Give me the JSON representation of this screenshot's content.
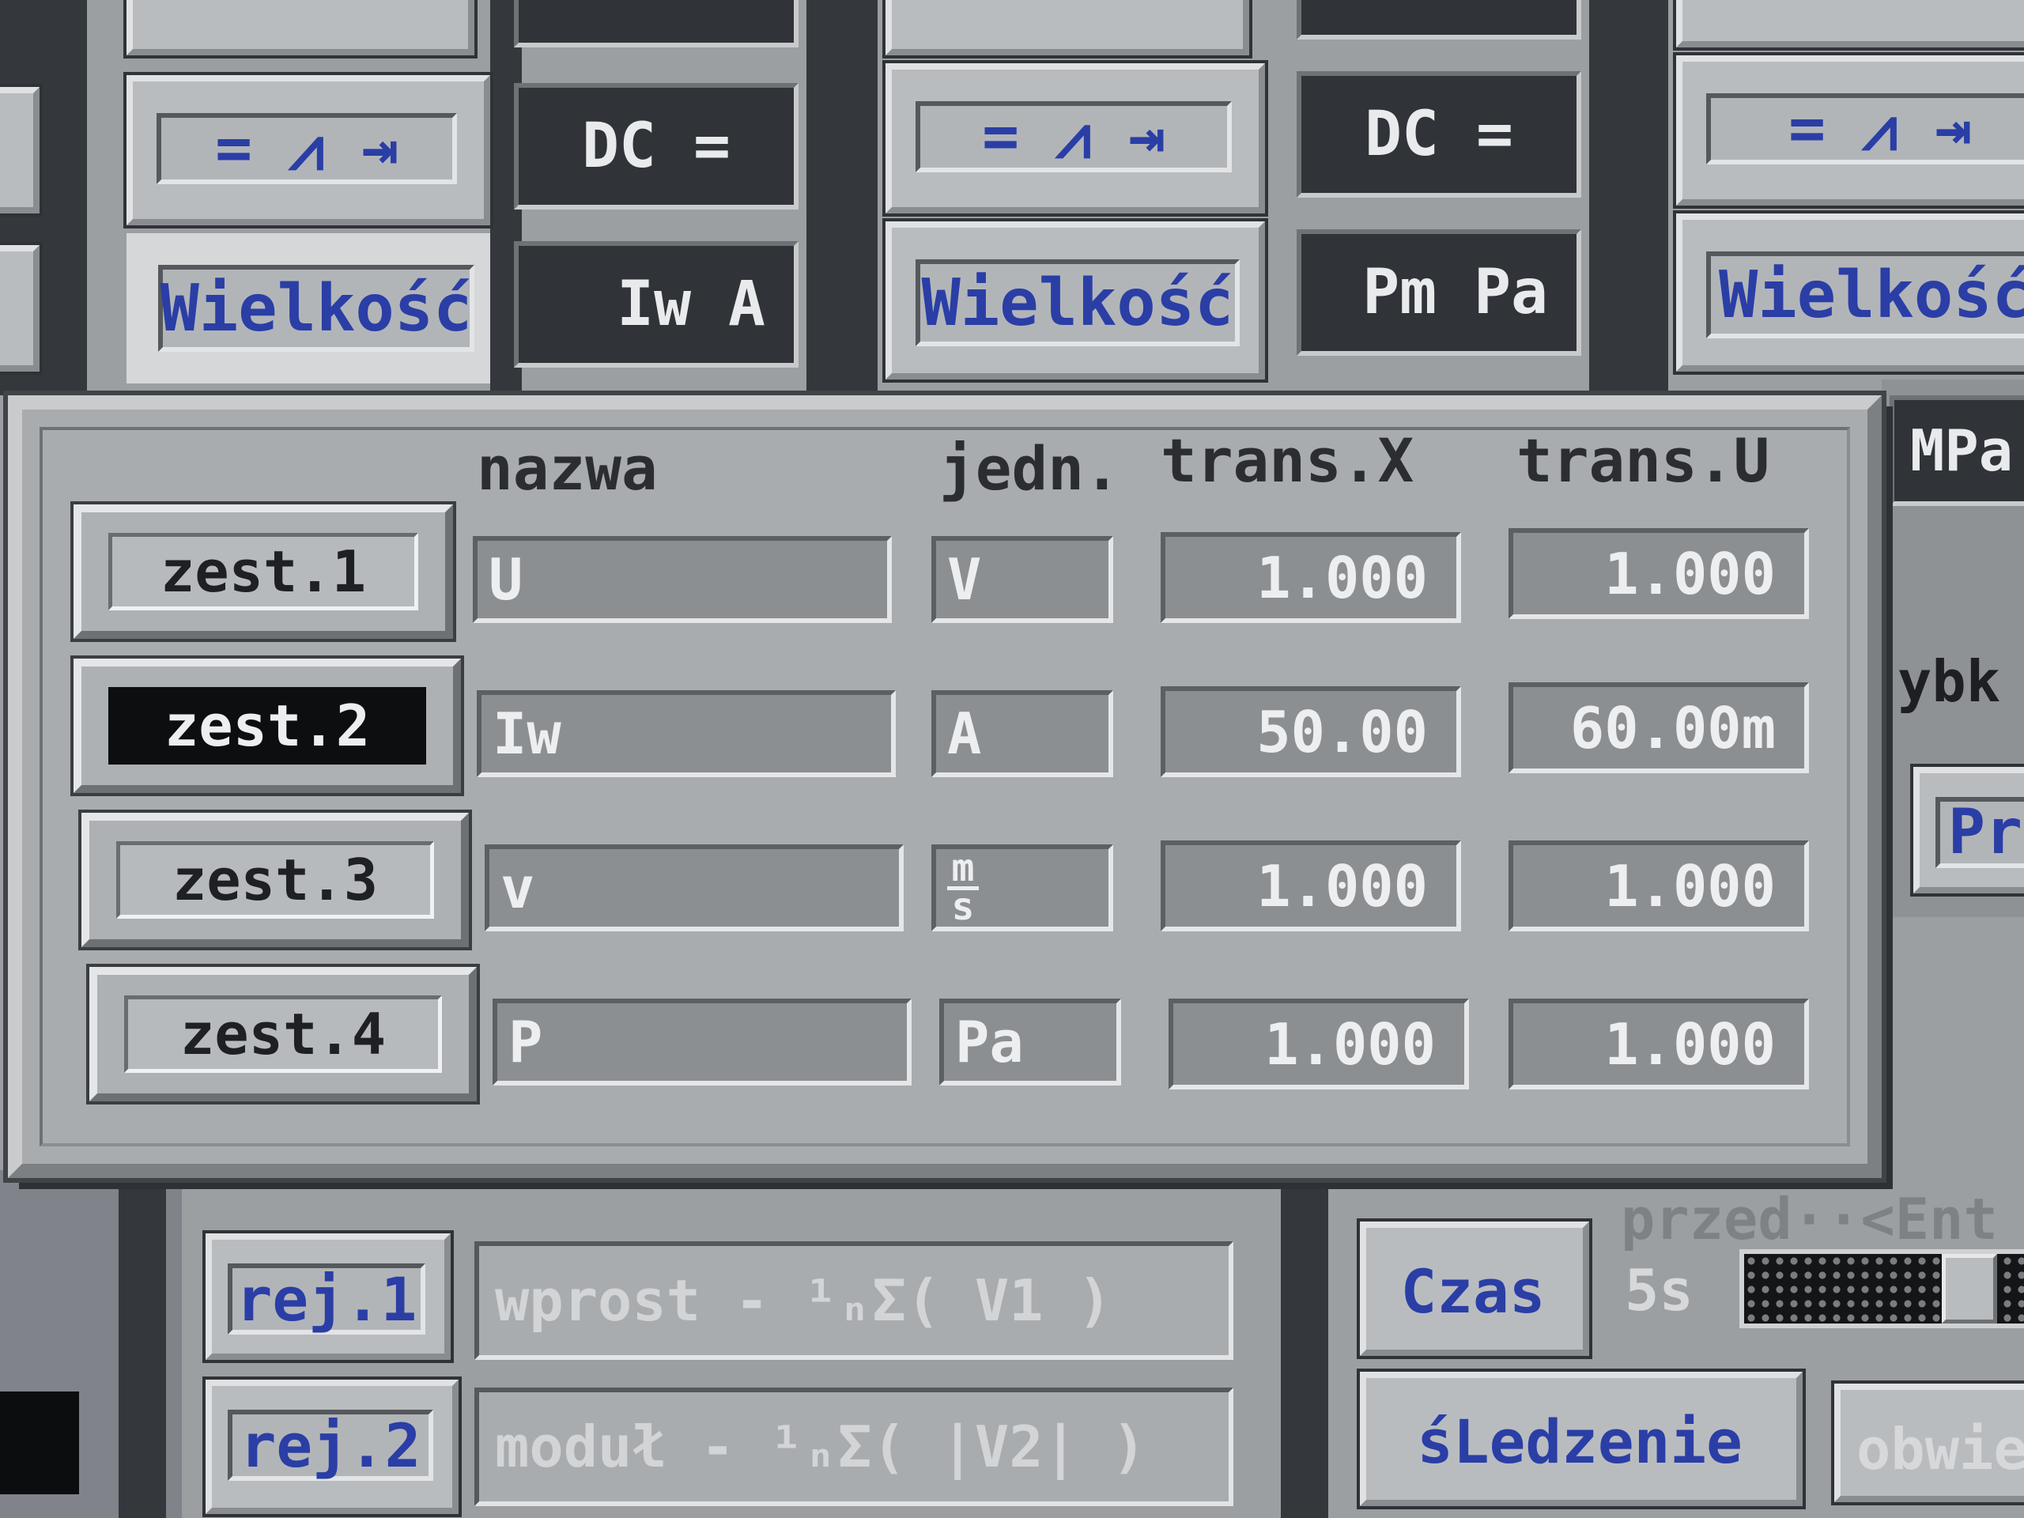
{
  "background": {
    "row_top": {
      "left": {
        "symbols": "= ⩘ ⇥",
        "dc": "DC =",
        "wielkosc": "Wielkość",
        "value": "Iw A"
      },
      "middle": {
        "symbols": "= ⩘ ⇥",
        "dc": "DC =",
        "wielkosc": "Wielkość",
        "value": "Pm Pa"
      },
      "right": {
        "symbols": "= ⩘ ⇥",
        "wielkosc": "Wielkość"
      }
    },
    "right_side": {
      "mpa": "MPa",
      "ybk": "ybk",
      "pr": "Pr"
    },
    "bottom": {
      "rej1": "rej.1",
      "rej1_formula": "wprost  -  ¹ₙΣ(  V1  )",
      "rej2": "rej.2",
      "rej2_formula": "moduł  -  ¹ₙΣ( |V2| )",
      "czas": "Czas",
      "przed": "przed··<Ent",
      "time": "5s",
      "sledzenie": "śLedzenie",
      "obwi": "obwie"
    }
  },
  "dialog": {
    "headers": {
      "name": "nazwa",
      "unit": "jedn.",
      "transx": "trans.X",
      "transu": "trans.U"
    },
    "rows": [
      {
        "set": "zest.1",
        "name": "U",
        "unit": "V",
        "transx": "1.000",
        "transu": "1.000",
        "active": false
      },
      {
        "set": "zest.2",
        "name": "Iw",
        "unit": "A",
        "transx": "50.00",
        "transu": "60.00m",
        "active": true
      },
      {
        "set": "zest.3",
        "name": "v",
        "unit_num": "m",
        "unit_den": "s",
        "transx": "1.000",
        "transu": "1.000",
        "active": false
      },
      {
        "set": "zest.4",
        "name": "P",
        "unit": "Pa",
        "transx": "1.000",
        "transu": "1.000",
        "active": false
      }
    ]
  },
  "colors": {
    "accent_blue": "#2a3ea6",
    "dialog_bg": "#a9acaf",
    "active_set_bg": "#0d0e10"
  }
}
